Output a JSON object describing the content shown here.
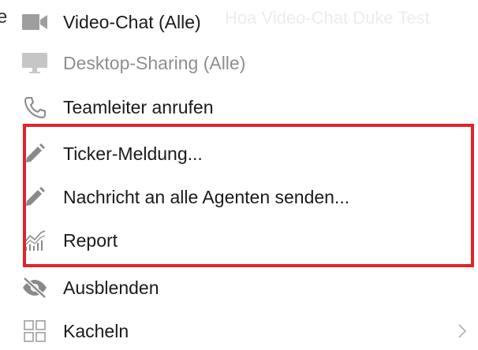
{
  "cut_fragment": "e",
  "ghost_text": "Hoa Video-Chat Duke Test",
  "menu": {
    "items": [
      {
        "label": "Video-Chat (Alle)",
        "icon": "video-camera-icon",
        "disabled": false
      },
      {
        "label": "Desktop-Sharing (Alle)",
        "icon": "monitor-icon",
        "disabled": true
      },
      {
        "label": "Teamleiter anrufen",
        "icon": "phone-icon",
        "disabled": false
      },
      {
        "label": "Ticker-Meldung...",
        "icon": "pencil-icon",
        "disabled": false
      },
      {
        "label": "Nachricht an alle Agenten senden...",
        "icon": "pencil-icon",
        "disabled": false
      },
      {
        "label": "Report",
        "icon": "chart-icon",
        "disabled": false
      },
      {
        "label": "Ausblenden",
        "icon": "eye-slash-icon",
        "disabled": false
      },
      {
        "label": "Kacheln",
        "icon": "tiles-icon",
        "disabled": false,
        "has_submenu": true
      }
    ]
  },
  "colors": {
    "highlight": "#e3232b",
    "icon_gray": "#9e9e9e",
    "text": "#1a1a1a",
    "disabled_text": "#8e8e8e"
  }
}
